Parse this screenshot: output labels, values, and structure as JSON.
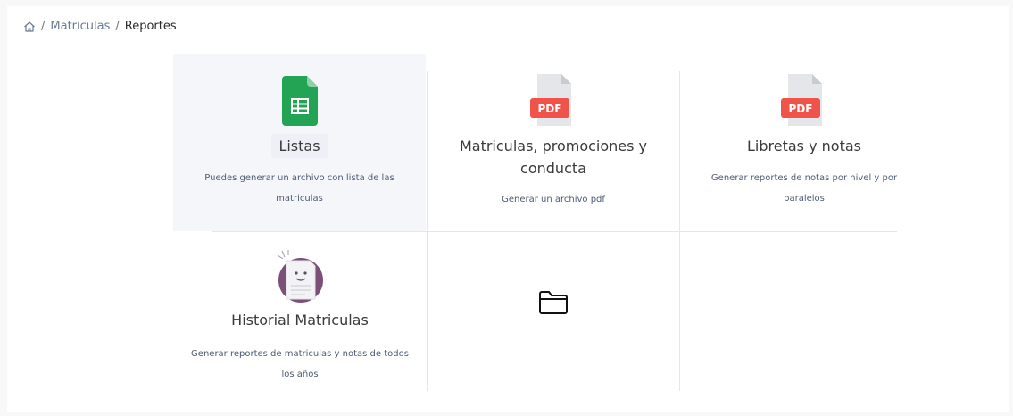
{
  "breadcrumb": {
    "home_icon": "home-icon",
    "separator": "/",
    "items": [
      "Matriculas",
      "Reportes"
    ]
  },
  "cards": [
    {
      "title": "Listas",
      "description": "Puedes generar un archivo con lista de las matriculas",
      "icon": "spreadsheet-icon"
    },
    {
      "title": "Matriculas, promociones y conducta",
      "description": "Generar un archivo pdf",
      "icon": "pdf-file-icon",
      "badge": "PDF"
    },
    {
      "title": "Libretas y notas",
      "description": "Generar reportes de notas por nivel y por paralelos",
      "icon": "pdf-file-icon",
      "badge": "PDF"
    },
    {
      "title": "Historial Matriculas",
      "description": "Generar reportes de matriculas y notas de todos los años",
      "icon": "history-document-icon"
    },
    {
      "icon": "folder-icon"
    }
  ],
  "colors": {
    "sheet_green": "#23a455",
    "pdf_red": "#f0534a",
    "file_gray": "#e4e6ea",
    "history_purple": "#7a5078"
  }
}
